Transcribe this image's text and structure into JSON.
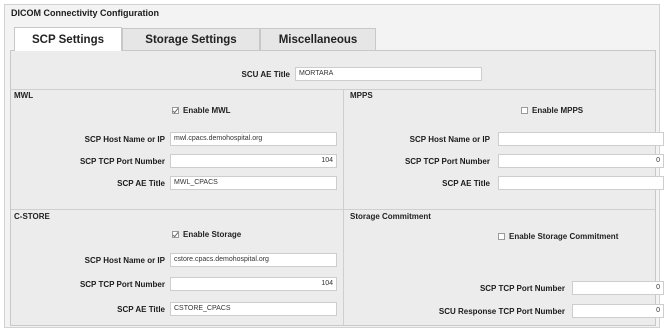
{
  "window": {
    "title": "DICOM Connectivity Configuration"
  },
  "tabs": [
    "SCP Settings",
    "Storage Settings",
    "Miscellaneous"
  ],
  "scu": {
    "label": "SCU AE Title",
    "value": "MORTARA"
  },
  "mwl": {
    "title": "MWL",
    "enable_label": "Enable MWL",
    "enabled": true,
    "host_label": "SCP Host Name or IP",
    "host_value": "mwl.cpacs.demohospital.org",
    "port_label": "SCP TCP Port Number",
    "port_value": "104",
    "ae_label": "SCP AE Title",
    "ae_value": "MWL_CPACS"
  },
  "mpps": {
    "title": "MPPS",
    "enable_label": "Enable MPPS",
    "enabled": false,
    "host_label": "SCP Host Name or IP",
    "host_value": "",
    "port_label": "SCP TCP Port Number",
    "port_value": "0",
    "ae_label": "SCP AE Title",
    "ae_value": ""
  },
  "cstore": {
    "title": "C-STORE",
    "enable_label": "Enable Storage",
    "enabled": true,
    "host_label": "SCP Host Name or IP",
    "host_value": "cstore.cpacs.demohospital.org",
    "port_label": "SCP TCP Port Number",
    "port_value": "104",
    "ae_label": "SCP AE Title",
    "ae_value": "CSTORE_CPACS"
  },
  "commit": {
    "title": "Storage Commitment",
    "enable_label": "Enable Storage Commitment",
    "enabled": false,
    "port_label": "SCP TCP Port Number",
    "port_value": "0",
    "resp_label": "SCU Response TCP Port Number",
    "resp_value": "0"
  }
}
